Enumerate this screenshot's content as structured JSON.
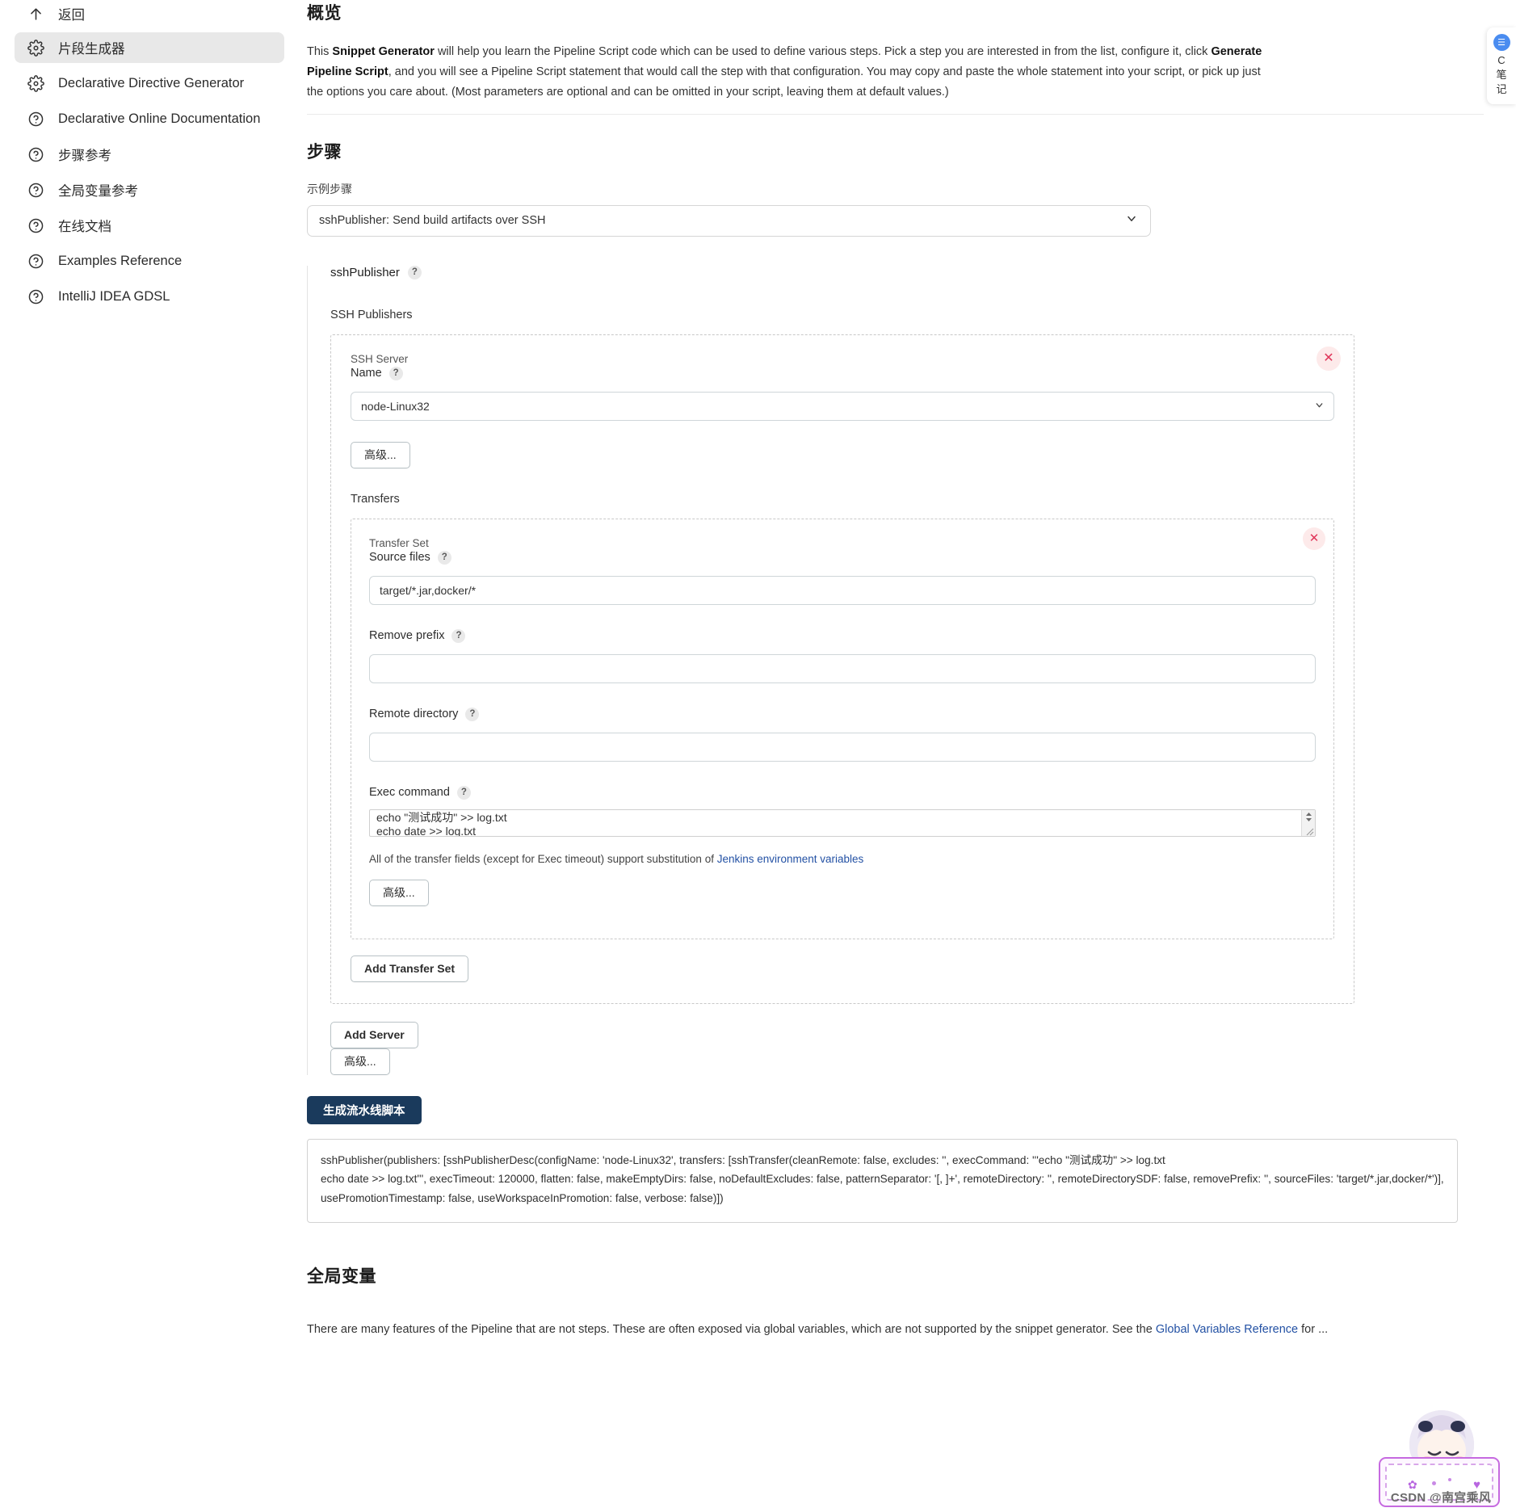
{
  "sidebar": {
    "items": [
      {
        "label": "返回",
        "icon": "arrow-up-icon",
        "name": "back",
        "active": false
      },
      {
        "label": "片段生成器",
        "icon": "gear-icon",
        "name": "snippet-generator",
        "active": true
      },
      {
        "label": "Declarative Directive Generator",
        "icon": "gear-icon",
        "name": "declarative-directive-generator",
        "active": false
      },
      {
        "label": "Declarative Online Documentation",
        "icon": "question-icon",
        "name": "declarative-online-documentation",
        "active": false
      },
      {
        "label": "步骤参考",
        "icon": "question-icon",
        "name": "steps-reference",
        "active": false
      },
      {
        "label": "全局变量参考",
        "icon": "question-icon",
        "name": "global-variables-reference",
        "active": false
      },
      {
        "label": "在线文档",
        "icon": "question-icon",
        "name": "online-documentation",
        "active": false
      },
      {
        "label": "Examples Reference",
        "icon": "question-icon",
        "name": "examples-reference",
        "active": false
      },
      {
        "label": "IntelliJ IDEA GDSL",
        "icon": "question-icon",
        "name": "intellij-idea-gdsl",
        "active": false
      }
    ]
  },
  "overview": {
    "heading": "概览",
    "p1_a": "This ",
    "p1_b": "Snippet Generator",
    "p1_c": " will help you learn the Pipeline Script code which can be used to define various steps. Pick a step you are interested in from the list, configure it, click ",
    "p1_d": "Generate Pipeline Script",
    "p1_e": ", and you will see a Pipeline Script statement that would call the step with that configuration. You may copy and paste the whole statement into your script, or pick up just the options you care about. (Most parameters are optional and can be omitted in your script, leaving them at default values.)"
  },
  "steps": {
    "heading": "步骤",
    "sample_step_label": "示例步骤",
    "selected_step": "sshPublisher: Send build artifacts over SSH",
    "step_options": [
      "sshPublisher: Send build artifacts over SSH"
    ]
  },
  "step_form": {
    "step_title": "sshPublisher",
    "help_glyph": "?",
    "publishers_label": "SSH Publishers",
    "server": {
      "group_label": "SSH Server",
      "name_label": "Name",
      "selected": "node-Linux32",
      "options": [
        "node-Linux32"
      ],
      "advanced_label": "高级...",
      "remove_glyph": "✕"
    },
    "transfers_label": "Transfers",
    "transfer_set": {
      "group_label": "Transfer Set",
      "source_files_label": "Source files",
      "source_files_value": "target/*.jar,docker/*",
      "remove_prefix_label": "Remove prefix",
      "remove_prefix_value": "",
      "remote_directory_label": "Remote directory",
      "remote_directory_value": "",
      "exec_command_label": "Exec command",
      "exec_command_value": "echo \"测试成功\" >> log.txt\necho date >> log.txt",
      "note_text": "All of the transfer fields (except for Exec timeout) support substitution of ",
      "note_link": "Jenkins environment variables",
      "advanced_label": "高级...",
      "remove_glyph": "✕"
    },
    "add_transfer_set_label": "Add Transfer Set",
    "add_server_label": "Add Server",
    "server_advanced_label": "高级..."
  },
  "generate": {
    "button_label": "生成流水线脚本",
    "script_output": "sshPublisher(publishers: [sshPublisherDesc(configName: 'node-Linux32', transfers: [sshTransfer(cleanRemote: false, excludes: '', execCommand: '''echo \"测试成功\" >> log.txt\necho date >> log.txt''', execTimeout: 120000, flatten: false, makeEmptyDirs: false, noDefaultExcludes: false, patternSeparator: '[, ]+', remoteDirectory: '', remoteDirectorySDF: false, removePrefix: '', sourceFiles: 'target/*.jar,docker/*')], usePromotionTimestamp: false, useWorkspaceInPromotion: false, verbose: false)])"
  },
  "global_variables": {
    "heading": "全局变量",
    "text_a": "There are many features of the Pipeline that are not steps. These are often exposed via global variables, which are not supported by the snippet generator. See the ",
    "link": "Global Variables Reference",
    "text_b": " for ..."
  },
  "right_widget": {
    "badge_glyph": "☰",
    "line1": "C",
    "line2": "笔",
    "line3": "记"
  },
  "watermark": {
    "text": "CSDN @南宫乘风",
    "heart": "♥",
    "star": "✿"
  },
  "colors": {
    "accent": "#1a3a5c",
    "link": "#2351a4",
    "danger": "#e0365a",
    "sidebar_active": "#e8e8e8"
  }
}
